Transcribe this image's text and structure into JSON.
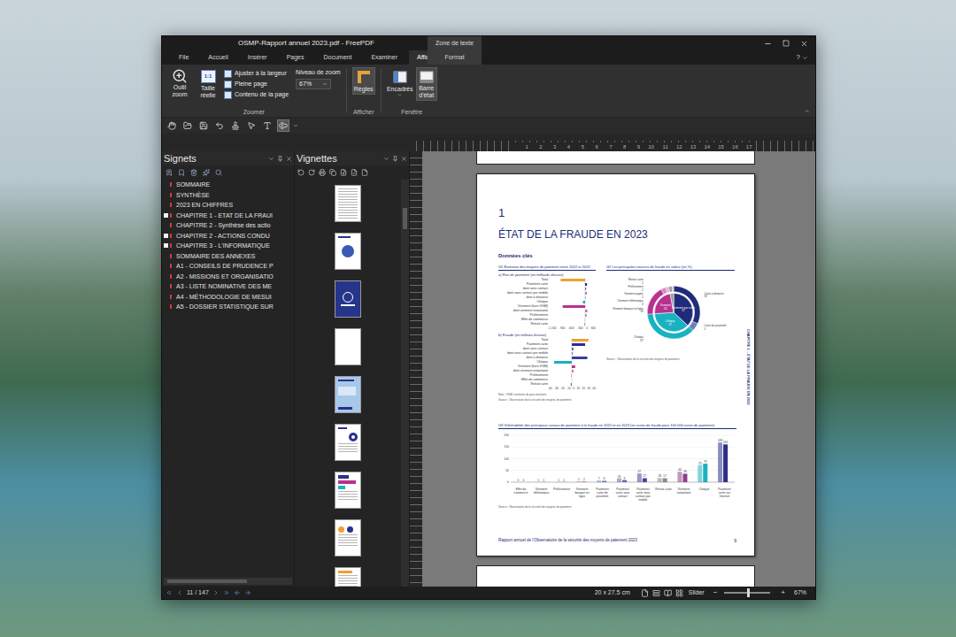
{
  "window": {
    "title": "OSMP-Rapport annuel 2023.pdf - FreePDF",
    "context_tab": "Zone de texte"
  },
  "tabs": [
    {
      "label": "File",
      "selected": false
    },
    {
      "label": "Accueil",
      "selected": false
    },
    {
      "label": "Insérer",
      "selected": false
    },
    {
      "label": "Pages",
      "selected": false
    },
    {
      "label": "Document",
      "selected": false
    },
    {
      "label": "Examiner",
      "selected": false
    },
    {
      "label": "Afficher",
      "selected": true
    },
    {
      "label": "Format",
      "selected": false
    }
  ],
  "help": "?",
  "ribbon": {
    "zoom_tool": "Outil zoom",
    "actual_size": {
      "label": "Taille réelle",
      "glyph": "1:1"
    },
    "fit_buttons": [
      "Ajuster à la largeur",
      "Pleine page",
      "Contenu de la page"
    ],
    "zoom_level": {
      "label": "Niveau de zoom",
      "value": "67%"
    },
    "groups": {
      "zoom": "Zoomer",
      "show": "Afficher",
      "window": "Fenêtre"
    },
    "rulers": {
      "label": "Règles",
      "selected": true
    },
    "panels": {
      "label": "Encadrés",
      "selected": false
    },
    "status_bar": {
      "label": "Barre d'état",
      "selected": true
    }
  },
  "quick_toolbar": [
    {
      "selected": false
    },
    {
      "selected": false
    },
    {
      "selected": false
    },
    {
      "selected": false
    },
    {
      "selected": false
    },
    {
      "selected": false
    },
    {
      "selected": false
    },
    {
      "selected": true
    }
  ],
  "bookmarks": {
    "title": "Signets",
    "items": [
      {
        "label": "SOMMAIRE",
        "expandable": false
      },
      {
        "label": "SYNTHÈSE",
        "expandable": false
      },
      {
        "label": "2023 EN CHIFFRES",
        "expandable": false
      },
      {
        "label": "CHAPITRE 1 - ETAT DE LA FRAUI",
        "expandable": true
      },
      {
        "label": "CHAPITRE 2 - Synthèse des actio",
        "expandable": false
      },
      {
        "label": "CHAPITRE 2 - ACTIONS CONDU",
        "expandable": true
      },
      {
        "label": "CHAPITRE 3 - L'INFORMATIQUE",
        "expandable": true
      },
      {
        "label": "SOMMAIRE DES ANNEXES",
        "expandable": false
      },
      {
        "label": "A1 - CONSEILS DE PRUDENCE P",
        "expandable": false
      },
      {
        "label": "A2 - MISSIONS ET ORGANISATIO",
        "expandable": false
      },
      {
        "label": "A3 - LISTE NOMINATIVE DES ME",
        "expandable": false
      },
      {
        "label": "A4 - MÉTHODOLOGIE DE MESUI",
        "expandable": false
      },
      {
        "label": "A5 - DOSSIER STATISTIQUE SUR",
        "expandable": false
      }
    ]
  },
  "thumbnails": {
    "title": "Vignettes",
    "scroll_level": 0.07,
    "pages": [
      {
        "kind": "text"
      },
      {
        "kind": "cover"
      },
      {
        "kind": "dark"
      },
      {
        "kind": "blank"
      },
      {
        "kind": "blue"
      },
      {
        "kind": "donut"
      },
      {
        "kind": "colored"
      },
      {
        "kind": "report"
      },
      {
        "kind": "table"
      }
    ]
  },
  "ruler": {
    "numbers": [
      "1",
      "2",
      "3",
      "4",
      "5",
      "6",
      "7",
      "8",
      "9",
      "10",
      "11",
      "12",
      "13",
      "14",
      "15",
      "16",
      "17"
    ]
  },
  "document": {
    "chapter_number": "1",
    "chapter_title": "ÉTAT DE LA FRAUDE EN 2023",
    "section": "Données clés",
    "side_text": "CHAPITRE 1 – ÉTAT DE LA FRAUDE EN 2023",
    "footer": "Rapport annuel de l'Observatoire de la sécurité des moyens de paiement 2023",
    "page_number": "9",
    "g1": {
      "title": "G1 Évolution des moyens de paiement entre 2022 et 2023",
      "rows": [
        {
          "label": "Total",
          "color": "#f0a030"
        },
        {
          "label": "Paiement carte",
          "color": "#2b2f8c"
        },
        {
          "label": "dont sans contact",
          "color": "#6a5fb0"
        },
        {
          "label": "dont sans contact par mobile",
          "color": "#8b85c8"
        },
        {
          "label": "dont à distance",
          "color": "#3a3f9a"
        },
        {
          "label": "Chèque",
          "color": "#19b2c0"
        },
        {
          "label": "Virement (hors VGM)",
          "color": "#b8318f"
        },
        {
          "label": "dont virement instantané",
          "color": "#d070b0"
        },
        {
          "label": "Prélèvement",
          "color": "#9a9a9a"
        },
        {
          "label": "Effet de commerce",
          "color": "#c0c0c0"
        },
        {
          "label": "Retrait carte",
          "color": "#7a7ab0"
        }
      ],
      "panels": [
        {
          "subtitle": "a) Flux de paiement (en milliards d'euros)",
          "min": -1200,
          "max": 300,
          "ticks": [
            "-1 200",
            "-900",
            "-600",
            "-300",
            "0",
            "300"
          ],
          "values": [
            -830,
            64,
            34,
            57,
            10,
            -75,
            -760,
            79,
            51,
            -13,
            -20
          ]
        },
        {
          "subtitle": "b) Fraude (en millions d'euros)",
          "min": -40,
          "max": 40,
          "ticks": [
            "-40",
            "-30",
            "-20",
            "-10",
            "0",
            "10",
            "20",
            "30",
            "40"
          ],
          "values": [
            30,
            24,
            3,
            2,
            28,
            -32,
            6,
            3,
            -1,
            0,
            -2
          ]
        }
      ],
      "note": "Note : VGM, virements de gros montants.",
      "source": "Source : Observatoire de la sécurité des moyens de paiement."
    },
    "g2": {
      "title": "G2 Les principales sources de fraude en valeur (en %)",
      "inner": [
        {
          "label": "Paiement par carte",
          "value_text": "37",
          "value": 37,
          "color": "#1f2a7a"
        },
        {
          "label": "Chèque",
          "value_text": "37",
          "value": 37,
          "color": "#19b2c0"
        },
        {
          "label": "Virement",
          "value_text": "23",
          "value": 23,
          "color": "#b8318f"
        },
        {
          "label": "",
          "value_text": "",
          "value": 3,
          "color": "#9a9a9a"
        }
      ],
      "outer": [
        {
          "label": "Carte à distance",
          "value_text": "32",
          "value": 32,
          "color": "#1f2a7a"
        },
        {
          "label": "Carte de proximité",
          "value_text": "5",
          "value": 5,
          "color": "#6e7fc0"
        },
        {
          "label": "Chèque",
          "value_text": "37",
          "value": 37,
          "color": "#19b2c0"
        },
        {
          "label": "Virement banque en ligne",
          "value_text": "18",
          "value": 18,
          "color": "#b8318f"
        },
        {
          "label": "Virement télématique",
          "value_text": "3",
          "value": 3,
          "color": "#d58bc2"
        },
        {
          "label": "Virement papier",
          "value_text": "2",
          "value": 2,
          "color": "#e3b5d7"
        },
        {
          "label": "Prélèvement",
          "value_text": "2",
          "value": 2,
          "color": "#9a9a9a"
        },
        {
          "label": "Retrait carte",
          "value_text": "1",
          "value": 1,
          "color": "#c7c7c7"
        }
      ],
      "source": "Source : Observatoire de la sécurité des moyens de paiement."
    },
    "g3": {
      "title": "G3 Vulnérabilité des principaux canaux de paiement à la fraude en 2022 et en 2023 (en euros de fraude pour 100 000 euros de paiement)",
      "max": 200,
      "ticks": [
        "0",
        "50",
        "100",
        "150",
        "200"
      ],
      "tick_values": [
        0,
        50,
        100,
        150,
        200
      ],
      "categories": [
        {
          "label": "Effet de commerce",
          "values": [
            0,
            0
          ],
          "color": "#b0b0b0"
        },
        {
          "label": "Virement télématique",
          "values": [
            1,
            1
          ],
          "color": "#d58bc2"
        },
        {
          "label": "Prélèvement",
          "values": [
            1,
            1
          ],
          "color": "#9a9a9a"
        },
        {
          "label": "Virement banque en ligne",
          "values": [
            2,
            2
          ],
          "color": "#b8318f"
        },
        {
          "label": "Paiement carte de proximité",
          "values": [
            7,
            6
          ],
          "color": "#6e7fc0"
        },
        {
          "label": "Paiement carte sans contact",
          "values": [
            16,
            9
          ],
          "color": "#6a5fb0"
        },
        {
          "label": "Paiement carte sans contact par mobile",
          "values": [
            37,
            17
          ],
          "color": "#4b3f9c"
        },
        {
          "label": "Retrait carte",
          "values": [
            18,
            17
          ],
          "color": "#8a8a8a"
        },
        {
          "label": "Virement instantané",
          "values": [
            44,
            36
          ],
          "color": "#8e3f8f"
        },
        {
          "label": "Chèque",
          "values": [
            73,
            79
          ],
          "color": "#19b2c0"
        },
        {
          "label": "Paiement carte sur Internet",
          "values": [
            169,
            161
          ],
          "color": "#2b2f8c"
        }
      ],
      "source": "Source : Observatoire de la sécurité des moyens de paiement."
    }
  },
  "status": {
    "page": "11 / 147",
    "size": "20 x 27.5 cm",
    "slider_label": "Slider",
    "minus": "−",
    "plus": "+",
    "zoom": "67%",
    "zoom_level": 0.5
  }
}
